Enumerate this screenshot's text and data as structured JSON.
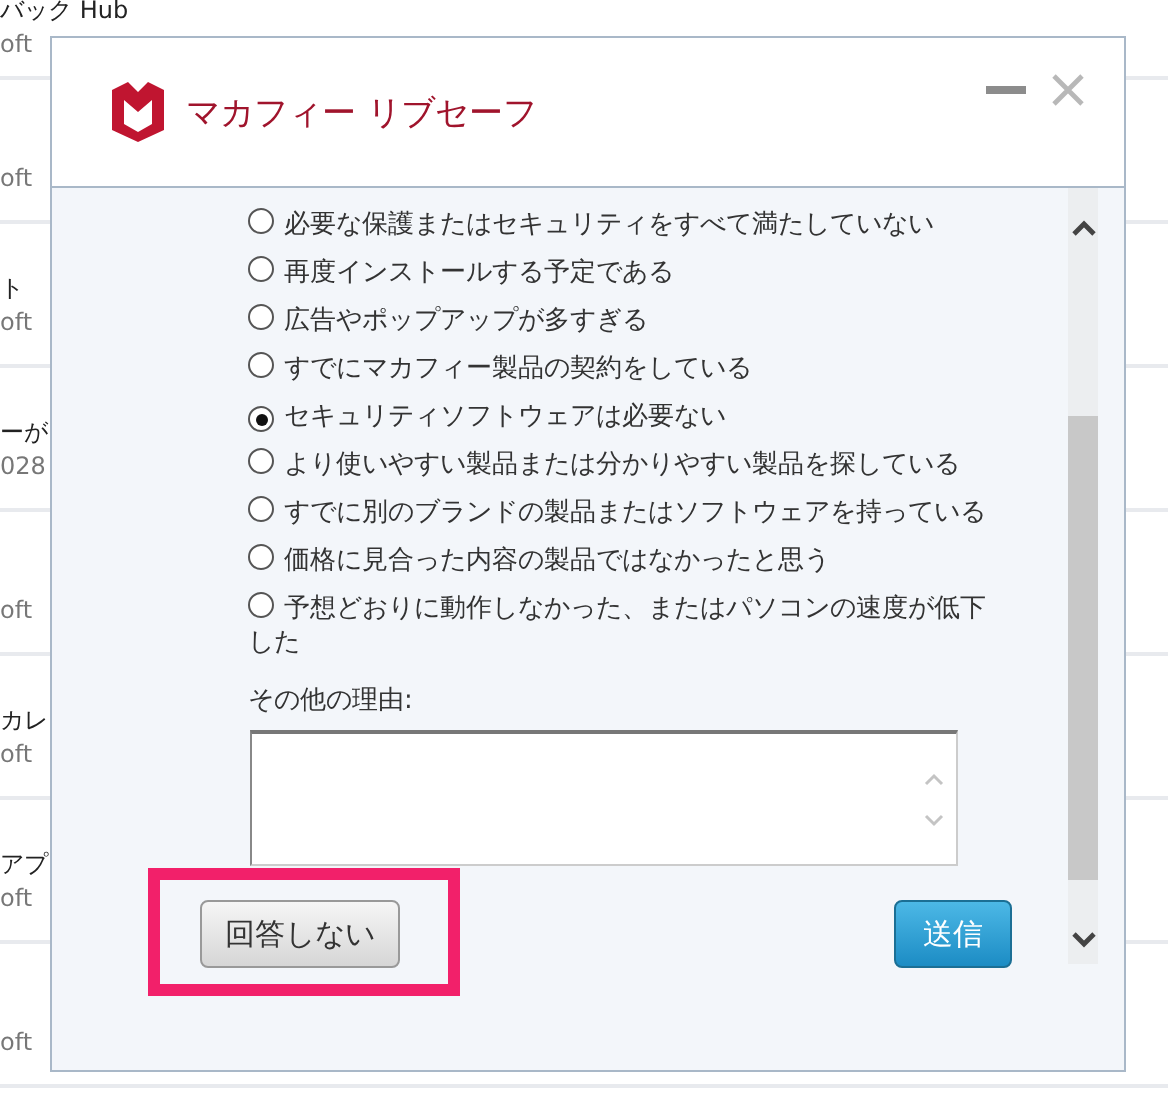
{
  "background_list": {
    "rows": [
      {
        "title": "バック Hub",
        "subtitle": "oft"
      },
      {
        "subtitle": "oft"
      },
      {
        "title": "ト",
        "subtitle": "oft"
      },
      {
        "title": "ーが",
        "subtitle": "028"
      },
      {
        "subtitle": "oft"
      },
      {
        "title": "カレ",
        "subtitle": "oft"
      },
      {
        "title": "アプ",
        "subtitle": "oft"
      },
      {
        "subtitle": "oft"
      }
    ]
  },
  "dialog": {
    "title": "マカフィー リブセーフ",
    "reasons": [
      {
        "label": "必要な保護またはセキュリティをすべて満たしていない",
        "selected": false
      },
      {
        "label": "再度インストールする予定である",
        "selected": false
      },
      {
        "label": "広告やポップアップが多すぎる",
        "selected": false
      },
      {
        "label": "すでにマカフィー製品の契約をしている",
        "selected": false
      },
      {
        "label": "セキュリティソフトウェアは必要ない",
        "selected": true
      },
      {
        "label": "より使いやすい製品または分かりやすい製品を探している",
        "selected": false
      },
      {
        "label": "すでに別のブランドの製品またはソフトウェアを持っている",
        "selected": false
      },
      {
        "label": "価格に見合った内容の製品ではなかったと思う",
        "selected": false
      },
      {
        "label": "予想どおりに動作しなかった、またはパソコンの速度が低下した",
        "selected": false
      }
    ],
    "other_reason": {
      "label": "その他の理由:"
    },
    "buttons": [
      {
        "label": "回答しない",
        "kind": "secondary"
      },
      {
        "label": "送信",
        "kind": "primary"
      }
    ]
  }
}
